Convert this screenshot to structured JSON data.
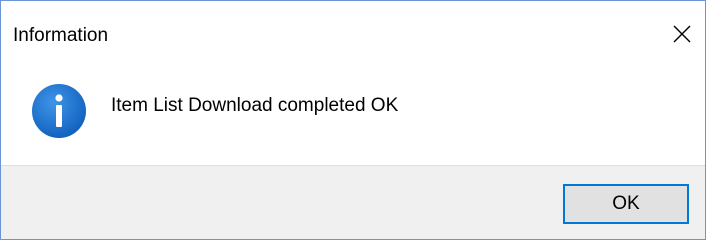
{
  "window": {
    "title": "Information",
    "close_icon": "close-icon"
  },
  "content": {
    "icon": "info-icon",
    "icon_color": "#1a6fc9",
    "message": "Item List Download completed OK"
  },
  "footer": {
    "ok_label": "OK",
    "ok_border_color": "#0078d7"
  }
}
